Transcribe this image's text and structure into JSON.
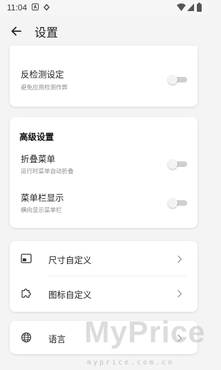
{
  "status_bar": {
    "time": "11:04",
    "icons": [
      "notification-a-icon",
      "shield-icon",
      "wifi-icon",
      "signal-icon",
      "battery-icon"
    ]
  },
  "header": {
    "title": "设置",
    "back_icon": "arrow-left-icon"
  },
  "card_anti_detect": {
    "label": "反检测设定",
    "description": "避免应用检测作弊",
    "toggle_on": false
  },
  "card_advanced": {
    "title": "高级设置",
    "items": [
      {
        "label": "折叠菜单",
        "description": "运行时菜单自动折叠",
        "toggle_on": false
      },
      {
        "label": "菜单栏显示",
        "description": "横向显示菜单栏",
        "toggle_on": false
      }
    ]
  },
  "card_custom": {
    "items": [
      {
        "label": "尺寸自定义",
        "icon": "resize-icon"
      },
      {
        "label": "图标自定义",
        "icon": "puzzle-icon"
      }
    ]
  },
  "card_language": {
    "label": "语言",
    "icon": "globe-icon"
  },
  "watermark": {
    "text": "MyPrice",
    "url": "myprice.com.cn"
  },
  "colors": {
    "background": "#f4f4f4",
    "card": "#ffffff",
    "toggle_track_off": "#cfcfcf",
    "toggle_thumb": "#f3f3f3",
    "secondary_text": "#8c8c8c"
  }
}
